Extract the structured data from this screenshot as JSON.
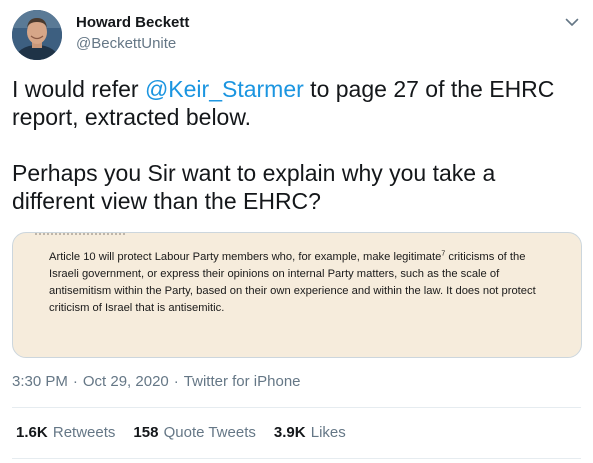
{
  "tweet": {
    "author": {
      "name": "Howard Beckett",
      "handle": "@BeckettUnite"
    },
    "text": {
      "p1_before": "I would refer ",
      "p1_mention": "@Keir_Starmer",
      "p1_after": " to page 27 of the EHRC report, extracted below.",
      "p2": "Perhaps you Sir want to explain why you take a different view than the EHRC?"
    },
    "media": {
      "excerpt": "Article 10 will protect Labour Party members who, for example, make legitimate",
      "footnote": "7",
      "excerpt_rest": " criticisms of the Israeli government, or express their opinions on internal Party matters, such as the scale of antisemitism within the Party, based on their own experience and within the law. It does not protect criticism of Israel that is antisemitic."
    },
    "meta": {
      "time": "3:30 PM",
      "separator": "·",
      "date": "Oct 29, 2020",
      "source": "Twitter for iPhone"
    },
    "stats": {
      "retweets_count": "1.6K",
      "retweets_label": "Retweets",
      "quotes_count": "158",
      "quotes_label": "Quote Tweets",
      "likes_count": "3.9K",
      "likes_label": "Likes"
    }
  },
  "icons": {
    "caret": "chevron-down-icon"
  },
  "colors": {
    "link": "#1b95e0",
    "secondary_text": "#657786",
    "primary_text": "#14171a",
    "media_background": "#f6ecdc",
    "divider": "#e6ecf0"
  }
}
